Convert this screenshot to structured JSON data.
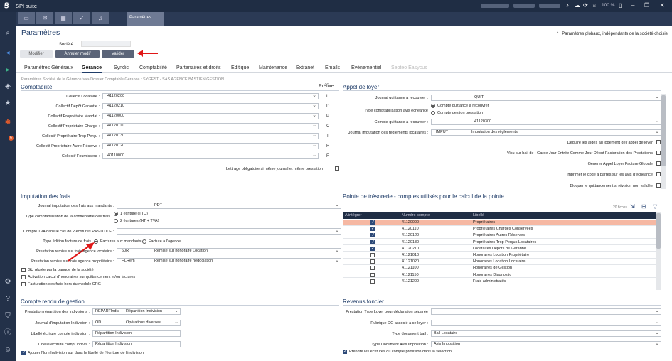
{
  "window": {
    "app_name": "SPI suite",
    "zoom": "100 %",
    "active_tab": "Paramètres"
  },
  "sidebar": {
    "icons": [
      "search-icon",
      "back-icon",
      "forward-icon",
      "share-icon",
      "star-icon",
      "bug-icon",
      "settings-icon",
      "help-icon",
      "shield-icon",
      "info-icon",
      "user-icon"
    ],
    "badge": "6"
  },
  "page": {
    "title": "Paramètres",
    "note": "* : Paramètres globaux, indépendants de la société choisie",
    "societe_label": "Société :"
  },
  "buttons": {
    "modifier": "Modifier",
    "annuler": "Annuler modif",
    "valider": "Valider"
  },
  "tabs": [
    "Paramètres Généraux",
    "Gérance",
    "Syndic",
    "Comptabilité",
    "Partenaires et droits",
    "Editique",
    "Maintenance",
    "Extranet",
    "Emails",
    "Evénementiel",
    "Septeo Easycus"
  ],
  "breadcrumb": "Paramètres Société de la Gérance >>> Dossier Comptable Gérance : SYGEST - SAS AGENCE BASTIEN GESTION",
  "comptabilite": {
    "title": "Comptabilité",
    "prefix_header": "Préfixe",
    "rows": [
      {
        "label": "Collectif Locataire :",
        "value": "41120200",
        "prefix": "L"
      },
      {
        "label": "Collectif Dépôt Garantie :",
        "value": "41120210",
        "prefix": "D"
      },
      {
        "label": "Collectif Propriétaire Mandat :",
        "value": "41120000",
        "prefix": "P"
      },
      {
        "label": "Collectif Propriétaire Charge :",
        "value": "41120110",
        "prefix": "C"
      },
      {
        "label": "Collectif Propriétaire Trop Perçu :",
        "value": "41120130",
        "prefix": "T"
      },
      {
        "label": "Collectif Propriétaire Autre Réserve :",
        "value": "41120120",
        "prefix": "R"
      },
      {
        "label": "Collectif Fournisseur :",
        "value": "40110000",
        "prefix": "F"
      }
    ],
    "lettrage": "Lettrage obligatoire si même journal et même prestation"
  },
  "appel": {
    "title": "Appel de loyer",
    "journal_label": "Journal quittance à recouvrer :",
    "journal_value": "QUIT",
    "type_label": "Type comptabilisation avis échéance",
    "type_opt1": "Compte quittance à recouvrer",
    "type_opt2": "Compte gestion prestation",
    "compte_label": "Compte quittance à recouvrer :",
    "compte_value": "41120300",
    "imput_label": "Journal imputation des règlements locataires :",
    "imput_code": "IMPUT",
    "imput_desc": "Imputation des règlements",
    "checks": [
      {
        "label": "Déduire les aides au logement de l'appel de loyer",
        "checked": false
      },
      {
        "label": "Visu sur bail de : Garde Jour Entrée Comme Jour Début Facturation des Prestations",
        "checked": false
      },
      {
        "label": "Generer Appel Loyer Facture Globale",
        "checked": false
      },
      {
        "label": "Imprimer le code à barres sur les avis d'échéance",
        "checked": false
      },
      {
        "label": "Bloquer le quittancement si révision non validée",
        "checked": false
      }
    ]
  },
  "imputation": {
    "title": "Imputation des frais",
    "journal_label": "Journal imputation des frais aux mandants :",
    "journal_value": "PDT",
    "contrepartie_label": "Type comptabilisation de la contrepartie des frais",
    "opt1": "1 écriture (TTC)",
    "opt2": "2 écritures (HT + TVA)",
    "tva_label": "Compte TVA dans le cas de 2 écritures PAS UTILE :",
    "edition_label": "Type édition facture de frais",
    "edition_opt1": "Factures aux mandants",
    "edition_opt2": "Facture à l'agence",
    "remise_loc_label": "Prestation remise sur frais agence locataire :",
    "remise_loc_code": "60R",
    "remise_loc_desc": "Remise sur honoraire Location",
    "remise_prop_label": "Prestation remise sur frais agence propriétaire :",
    "remise_prop_code": "HLRem",
    "remise_prop_desc": "Remise sur honoraire négociation",
    "checks": [
      "GU réglée par la banque de la société",
      "Activation calcul d'honoraires sur quittancement et/ou factures",
      "Facturation des frais hors du module CRG"
    ]
  },
  "tresorerie": {
    "title": "Pointe de trésorerie - comptes utilisés pour le calcul de la pointe",
    "count": "20 fiches",
    "headers": [
      "A intégrer",
      "Numéro compte",
      "Libellé"
    ],
    "rows": [
      {
        "checked": true,
        "num": "41120000",
        "lib": "Propriétaires",
        "selected": true
      },
      {
        "checked": true,
        "num": "41120110",
        "lib": "Propriétaires Charges Conservées",
        "selected": false
      },
      {
        "checked": true,
        "num": "41120120",
        "lib": "Propriétaires Autres Réserves",
        "selected": false
      },
      {
        "checked": true,
        "num": "41120130",
        "lib": "Propriétaires Trop Perçus Locataires",
        "selected": false
      },
      {
        "checked": true,
        "num": "41120210",
        "lib": "Locataires Dépôts de Garantie",
        "selected": false
      },
      {
        "checked": false,
        "num": "41121010",
        "lib": "Honoraires Location Propriétaire",
        "selected": false
      },
      {
        "checked": false,
        "num": "41121020",
        "lib": "Honoraires Location Locataire",
        "selected": false
      },
      {
        "checked": false,
        "num": "41121100",
        "lib": "Honoraires de Gestion",
        "selected": false
      },
      {
        "checked": false,
        "num": "41121150",
        "lib": "Honoraires Diagnostic",
        "selected": false
      },
      {
        "checked": false,
        "num": "41121200",
        "lib": "Frais administratifs",
        "selected": false
      }
    ]
  },
  "crg": {
    "title": "Compte rendu de gestion",
    "rep_label": "Prestation répartition des indivisions :",
    "rep_code": "REPARTIndiv",
    "rep_desc": "Répartition Indivision",
    "journal_label": "Journal d'imputation Indivision :",
    "journal_code": "OD",
    "journal_desc": "Opérations diverses",
    "lib1_label": "Libellé écriture compte indivision :",
    "lib1_value": "Répartition Indivision",
    "lib2_label": "Libellé écriture compt indivis :",
    "lib2_value": "Répartition Indivision",
    "check": "Ajouter Nom Indivision sur dans le libellé de l'écriture de l'indivision"
  },
  "revenus": {
    "title": "Revenus foncier",
    "r1_label": "Prestation Type Loyer pour déclaration séparée",
    "r2_label": "Rubrique DG associé à ce loyer :",
    "r3_label": "Type document bail :",
    "r3_value": "Bail Locataire",
    "r4_label": "Type Document Avis Imposition :",
    "r4_value": "Avis Imposition",
    "check": "Prendre les écritures du compte provision dans la sélection"
  }
}
